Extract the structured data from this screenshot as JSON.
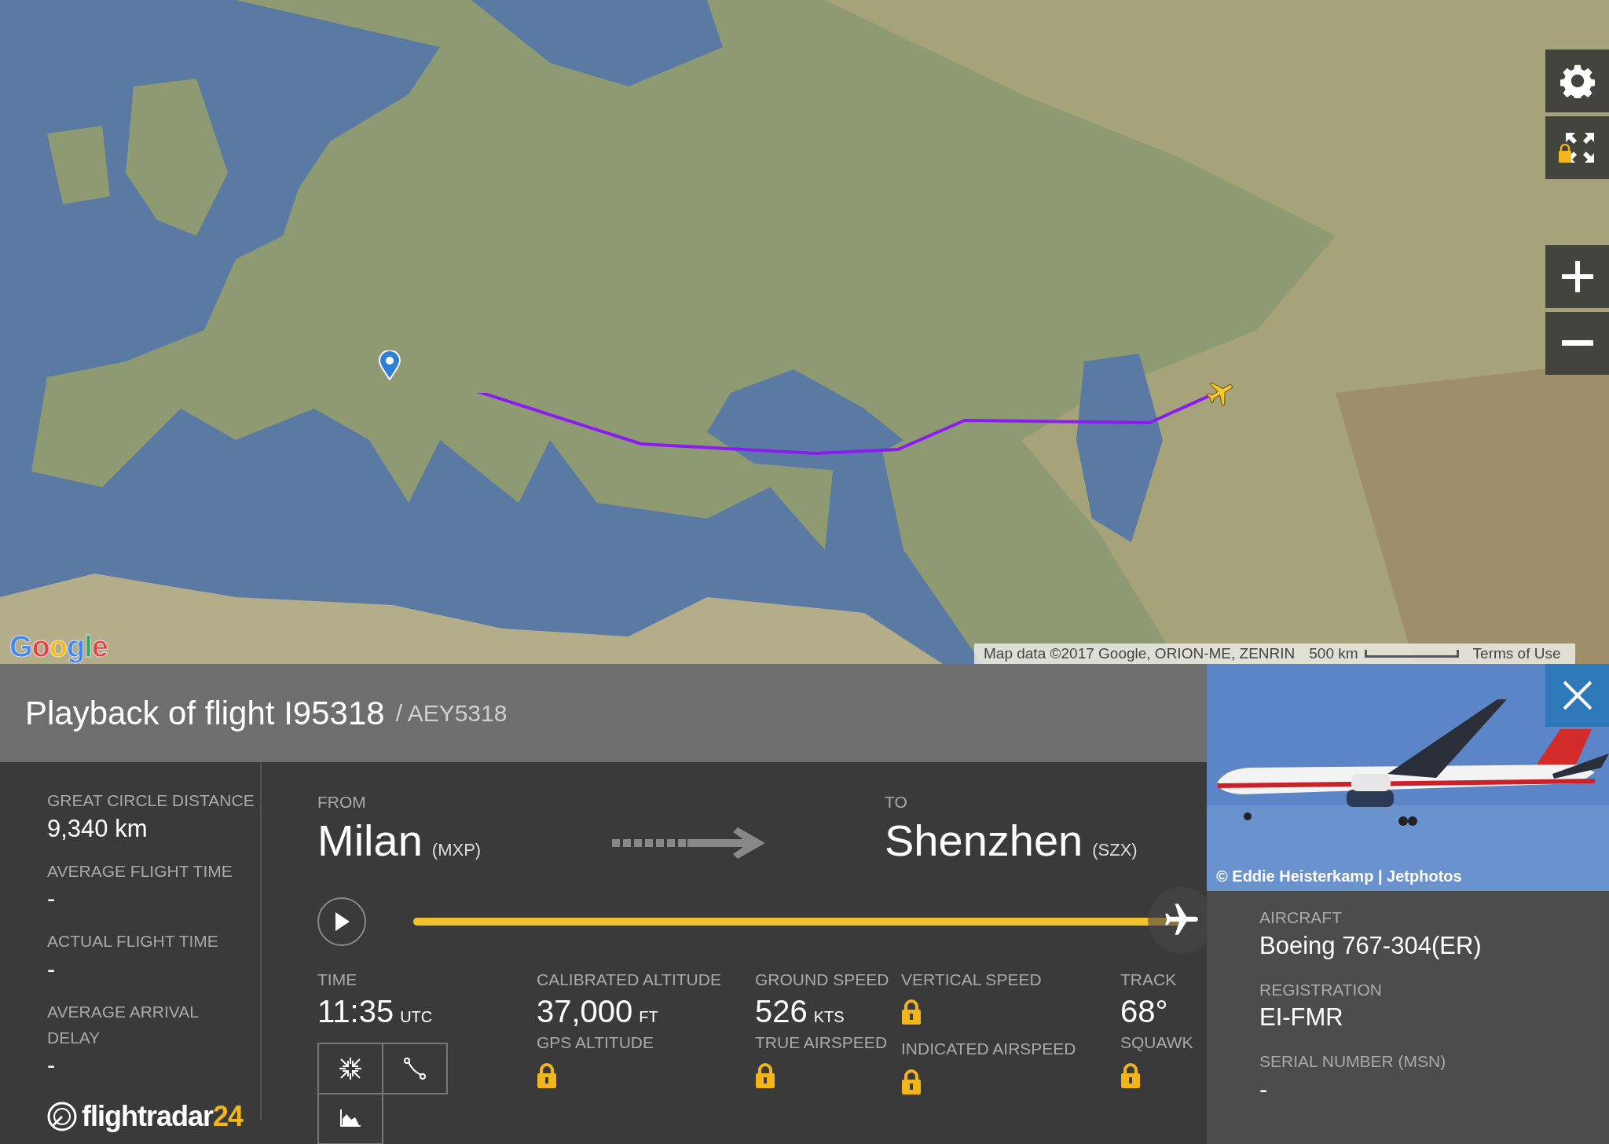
{
  "map": {
    "kind": "picture",
    "logo": "Google",
    "attribution": "Map data ©2017 Google, ORION-ME, ZENRIN",
    "scale": "500 km",
    "terms": "Terms of Use"
  },
  "header": {
    "title": "Playback of flight I95318",
    "callsign": "/ AEY5318"
  },
  "summary": [
    {
      "label": "GREAT CIRCLE DISTANCE",
      "value": "9,340 km"
    },
    {
      "label": "AVERAGE FLIGHT TIME",
      "value": "-"
    },
    {
      "label": "ACTUAL FLIGHT TIME",
      "value": "-"
    },
    {
      "label": "AVERAGE ARRIVAL DELAY",
      "value": "-"
    }
  ],
  "brand": {
    "name": "flightradar",
    "number": "24"
  },
  "route": {
    "from": {
      "label": "FROM",
      "city": "Milan",
      "code": "(MXP)"
    },
    "to": {
      "label": "TO",
      "city": "Shenzhen",
      "code": "(SZX)"
    }
  },
  "playback": {
    "playing": false,
    "level": 1
  },
  "stats": [
    [
      {
        "label": "TIME",
        "value": "11:35",
        "unit": "UTC",
        "locked": false
      }
    ],
    [
      {
        "label": "CALIBRATED ALTITUDE",
        "value": "37,000",
        "unit": "FT",
        "locked": false
      },
      {
        "label": "GPS ALTITUDE",
        "locked": true
      }
    ],
    [
      {
        "label": "GROUND SPEED",
        "value": "526",
        "unit": "KTS",
        "locked": false
      },
      {
        "label": "TRUE AIRSPEED",
        "locked": true
      }
    ],
    [
      {
        "label": "VERTICAL SPEED",
        "locked": true
      },
      {
        "label": "INDICATED AIRSPEED",
        "locked": true
      }
    ],
    [
      {
        "label": "TRACK",
        "value": "68°",
        "locked": false
      },
      {
        "label": "SQUAWK",
        "locked": true
      }
    ]
  ],
  "aircraft": {
    "photo": {
      "kind": "picture",
      "credit": "© Eddie Heisterkamp | Jetphotos"
    },
    "fields": [
      {
        "label": "AIRCRAFT",
        "value": "Boeing 767-304(ER)"
      },
      {
        "label": "REGISTRATION",
        "value": "EI-FMR"
      },
      {
        "label": "SERIAL NUMBER (MSN)",
        "value": "-"
      }
    ]
  }
}
